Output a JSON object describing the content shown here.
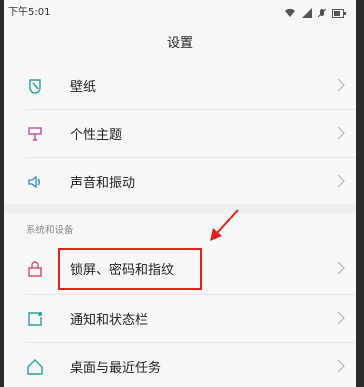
{
  "status_bar": {
    "time": "下午5:01"
  },
  "header": {
    "title": "设置"
  },
  "rows_top": [
    {
      "label": "壁纸",
      "icon": "wallpaper-icon"
    },
    {
      "label": "个性主题",
      "icon": "theme-brush-icon"
    },
    {
      "label": "声音和振动",
      "icon": "speaker-icon"
    }
  ],
  "section": {
    "title": "系统和设备"
  },
  "rows_bottom": [
    {
      "label": "锁屏、密码和指纹",
      "icon": "lock-icon"
    },
    {
      "label": "通知和状态栏",
      "icon": "notification-icon"
    },
    {
      "label": "桌面与最近任务",
      "icon": "home-icon"
    }
  ],
  "colors": {
    "accent": "#2aa29a",
    "lock": "#d94b63",
    "theme": "#b9559a",
    "annotation": "#e0211c"
  }
}
